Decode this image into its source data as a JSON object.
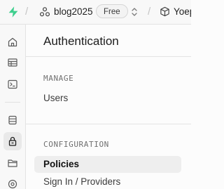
{
  "topbar": {
    "logo_icon": "supabase-bolt-icon",
    "separator": "/",
    "org_icon": "organization-icon",
    "project_name": "blog2025",
    "plan_badge": "Free",
    "switch_icon": "chevron-up-down-icon",
    "branch_icon": "box-icon",
    "branch_name": "Yoep"
  },
  "rail": {
    "items": [
      {
        "icon": "home-icon"
      },
      {
        "icon": "table-editor-icon"
      },
      {
        "icon": "sql-editor-icon"
      },
      {
        "icon": "database-icon"
      },
      {
        "icon": "authentication-lock-icon",
        "active": true
      },
      {
        "icon": "storage-icon"
      },
      {
        "icon": "edge-functions-icon"
      }
    ]
  },
  "menu": {
    "title": "Authentication",
    "sections": [
      {
        "heading": "MANAGE",
        "items": [
          {
            "label": "Users"
          }
        ]
      },
      {
        "heading": "CONFIGURATION",
        "items": [
          {
            "label": "Policies",
            "selected": true
          },
          {
            "label": "Sign In / Providers"
          }
        ]
      }
    ]
  },
  "colors": {
    "accent": "#3ecf8e",
    "selected_bg": "#eeeeee",
    "border": "#e3e3e3"
  }
}
